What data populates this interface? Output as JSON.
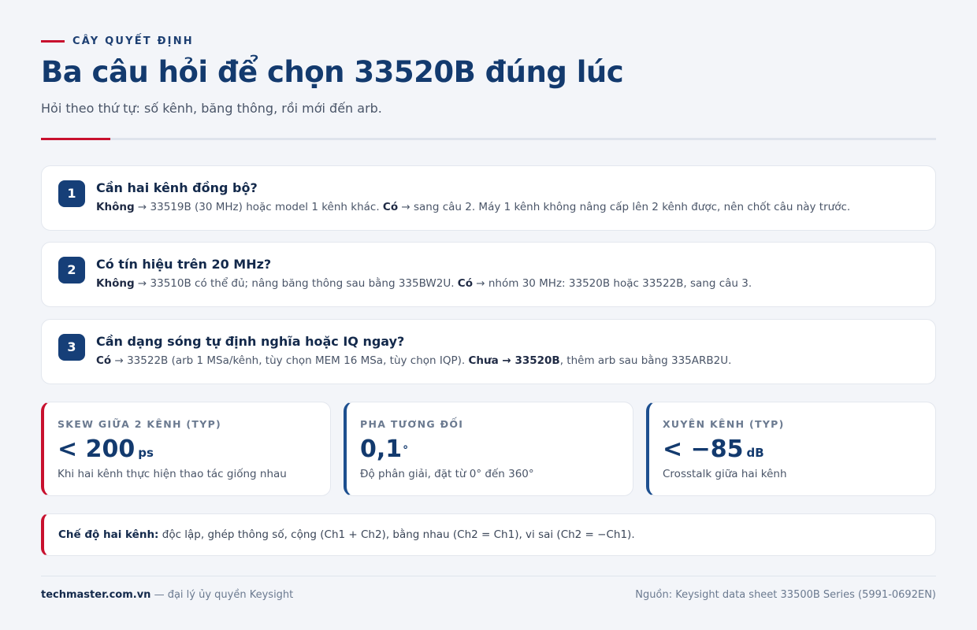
{
  "header": {
    "kicker": "CÂY QUYẾT ĐỊNH",
    "title": "Ba câu hỏi để chọn 33520B đúng lúc",
    "subtitle": "Hỏi theo thứ tự: số kênh, băng thông, rồi mới đến arb."
  },
  "questions": [
    {
      "number": "1",
      "title": "Cần hai kênh đồng bộ?",
      "no_label": "Không",
      "no_text": " → 33519B (30 MHz) hoặc model 1 kênh khác. ",
      "yes_label": "Có",
      "yes_text": " → sang câu 2. Máy 1 kênh không nâng cấp lên 2 kênh được, nên chốt câu này trước."
    },
    {
      "number": "2",
      "title": "Có tín hiệu trên 20 MHz?",
      "no_label": "Không",
      "no_text": " → 33510B có thể đủ; nâng băng thông sau bằng 335BW2U. ",
      "yes_label": "Có",
      "yes_text": " → nhóm 30 MHz: 33520B hoặc 33522B, sang câu 3."
    },
    {
      "number": "3",
      "title": "Cần dạng sóng tự định nghĩa hoặc IQ ngay?",
      "yes_label": "Có",
      "yes_text": " → 33522B (arb 1 MSa/kênh, tùy chọn MEM 16 MSa, tùy chọn IQP). ",
      "not_yet_label": "Chưa",
      "arrow": " → ",
      "pick": "33520B",
      "tail": ", thêm arb sau bằng 335ARB2U."
    }
  ],
  "stats": [
    {
      "label": "SKEW GIỮA 2 KÊNH (TYP)",
      "value": "< 200",
      "unit": "ps",
      "desc": "Khi hai kênh thực hiện thao tác giống nhau",
      "accent": "#c8102e"
    },
    {
      "label": "PHA TƯƠNG ĐỐI",
      "value": "0,1",
      "unit": "°",
      "desc": "Độ phân giải, đặt từ 0° đến 360°",
      "accent": "#1d4f8f"
    },
    {
      "label": "XUYÊN KÊNH (TYP)",
      "value": "< −85",
      "unit": "dB",
      "desc": "Crosstalk giữa hai kênh",
      "accent": "#1d4f8f"
    }
  ],
  "note": {
    "label": "Chế độ hai kênh:",
    "text": " độc lập, ghép thông số, cộng (Ch1 + Ch2), bằng nhau (Ch2 = Ch1), vi sai (Ch2 = −Ch1)."
  },
  "footer": {
    "site": "techmaster.com.vn",
    "tagline": " — đại lý ủy quyền Keysight",
    "source": "Nguồn: Keysight data sheet 33500B Series (5991-0692EN)"
  },
  "colors": {
    "brand_navy": "#133a6e",
    "accent_red": "#c8102e",
    "background": "#f3f5f9"
  }
}
